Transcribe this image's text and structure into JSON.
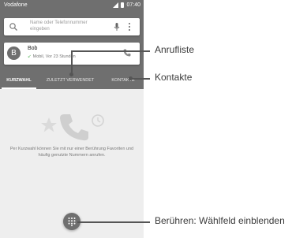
{
  "status_bar": {
    "carrier": "Vodafone",
    "time": "07:40"
  },
  "search": {
    "placeholder": "Name oder Telefonnummer eingeben"
  },
  "recent_call": {
    "initial": "B",
    "name": "Bob",
    "info": "Mobil, Vor 23 Stunden"
  },
  "tabs": [
    {
      "label": "KURZWAHL"
    },
    {
      "label": "ZULETZT VERWENDET"
    },
    {
      "label": "KONTAKTE"
    }
  ],
  "empty_state": {
    "text": "Per Kurzwahl können Sie mit nur einer Berührung Favoriten und häufig genutzte Nummern anrufen."
  },
  "callouts": {
    "call_list": "Anrufliste",
    "contacts": "Kontakte",
    "dialpad": "Berühren: Wählfeld einblenden"
  },
  "colors": {
    "appbar": "#6f6f6f",
    "background": "#eeeeee",
    "callout": "#555555"
  }
}
